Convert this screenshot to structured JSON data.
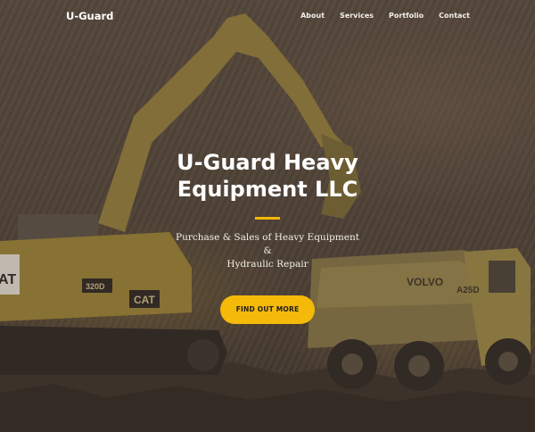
{
  "nav": {
    "brand": "U-Guard",
    "links": [
      "About",
      "Services",
      "Portfolio",
      "Contact"
    ]
  },
  "hero": {
    "title": "U-Guard Heavy Equipment LLC",
    "subtitle_line1": "Purchase & Sales of Heavy Equipment",
    "subtitle_amp": "&",
    "subtitle_line2": "Hydraulic Repair",
    "cta_label": "FIND OUT MORE",
    "background_image": {
      "excavator_marking": "CAT",
      "excavator_model": "320D",
      "excavator_side_label": "AT",
      "truck_brand": "VOLVO",
      "truck_model": "A25D"
    }
  },
  "colors": {
    "accent": "#f5b90a",
    "text": "#ffffff"
  }
}
